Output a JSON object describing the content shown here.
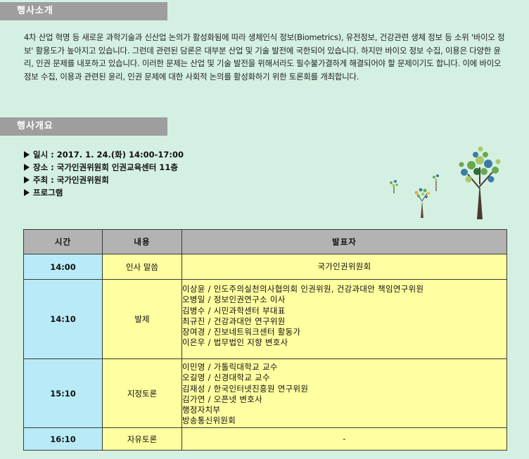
{
  "sections": {
    "intro_title": "행사소개",
    "overview_title": "행사개요"
  },
  "intro_text": "4차 산업 혁명 등 새로운 과학기술과 신산업 논의가 활성화됨에 따라 생체인식 정보(Biometrics), 유전정보, 건강관련 생체 정보 등 소위 '바이오 정보' 활용도가 높아지고 있습니다. 그런데 관련된 담론은 대부분 산업 및 기술 발전에 국한되어 있습니다. 하지만 바이오 정보 수집, 이용은 다양한 윤리, 인권 문제를 내포하고 있습니다. 이러한 문제는 산업 및 기술 발전을 위해서라도 필수불가결하게 해결되어야 할 문제이기도 합니다. 이에 바이오 정보 수집, 이용과 관련된 윤리, 인권 문제에 대한 사회적 논의를 활성화하기 위한 토론회를 개최합니다.",
  "overview": {
    "date": "일시 : 2017. 1. 24.(화) 14:00-17:00",
    "place": "장소 : 국가인권위원회 인권교육센터 11층",
    "host": "주최 : 국가인권위원회",
    "program": "프로그램"
  },
  "table": {
    "headers": [
      "시간",
      "내용",
      "발표자"
    ],
    "rows": [
      {
        "time": "14:00",
        "content": "인사 말씀",
        "speakers": [
          "국가인권위원회"
        ]
      },
      {
        "time": "14:10",
        "content": "발제",
        "speakers": [
          "이상윤 / 인도주의실천의사협의회 인권위원, 건강과대안 책임연구위원",
          "오병일 / 정보인권연구소 이사",
          "김병수 / 시민과학센터 부대표",
          "최규진 / 건강과대안 연구위원",
          "장여경 / 진보네트워크센터 활동가",
          "이은우 / 법무법인 지향 변호사"
        ]
      },
      {
        "time": "15:10",
        "content": "지정토론",
        "speakers": [
          "이민영 / 가톨릭대학교 교수",
          "오길영 / 신경대학교 교수",
          "김재성 / 한국인터넷진흥원 연구위원",
          "김가연 / 오픈넷 변호사",
          "행정자치부",
          "방송통신위원회"
        ]
      },
      {
        "time": "16:10",
        "content": "자유토론",
        "speakers": [
          "-"
        ]
      }
    ]
  }
}
